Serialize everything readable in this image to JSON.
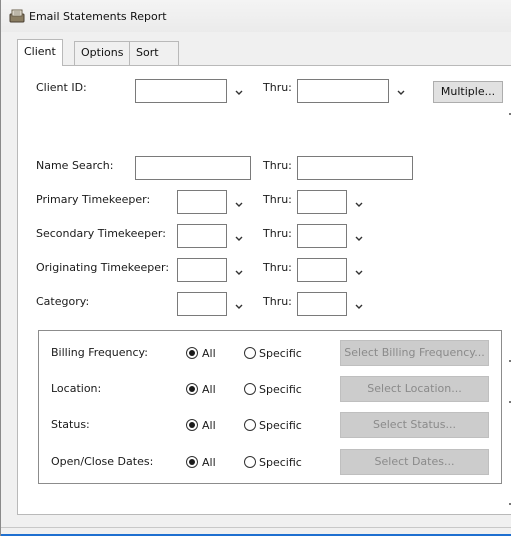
{
  "window": {
    "title": "Email Statements Report"
  },
  "tabs": [
    {
      "label": "Client",
      "active": true
    },
    {
      "label": "Options",
      "active": false
    },
    {
      "label": "Sort",
      "active": false
    }
  ],
  "form": {
    "client_id_label": "Client ID:",
    "client_id_value": "",
    "client_thru_label": "Thru:",
    "client_thru_value": "",
    "multiple_button": "Multiple...",
    "name_search_label": "Name Search:",
    "name_search_value": "",
    "name_thru_label": "Thru:",
    "name_thru_value": "",
    "primary_label": "Primary Timekeeper:",
    "primary_thru_label": "Thru:",
    "secondary_label": "Secondary Timekeeper:",
    "secondary_thru_label": "Thru:",
    "originating_label": "Originating Timekeeper:",
    "originating_thru_label": "Thru:",
    "category_label": "Category:",
    "category_thru_label": "Thru:"
  },
  "filters": [
    {
      "label": "Billing Frequency:",
      "all_label": "All",
      "specific_label": "Specific",
      "selected": "All",
      "button": "Select Billing Frequency..."
    },
    {
      "label": "Location:",
      "all_label": "All",
      "specific_label": "Specific",
      "selected": "All",
      "button": "Select Location..."
    },
    {
      "label": "Status:",
      "all_label": "All",
      "specific_label": "Specific",
      "selected": "All",
      "button": "Select Status..."
    },
    {
      "label": "Open/Close Dates:",
      "all_label": "All",
      "specific_label": "Specific",
      "selected": "All",
      "button": "Select Dates..."
    }
  ],
  "icons": {
    "title": "report-window-icon",
    "dropdown": "chevron-down-icon"
  },
  "colors": {
    "accent": "#1e6fd0",
    "panel": "#f0f0f0",
    "disabled_button": "#cccccc"
  }
}
